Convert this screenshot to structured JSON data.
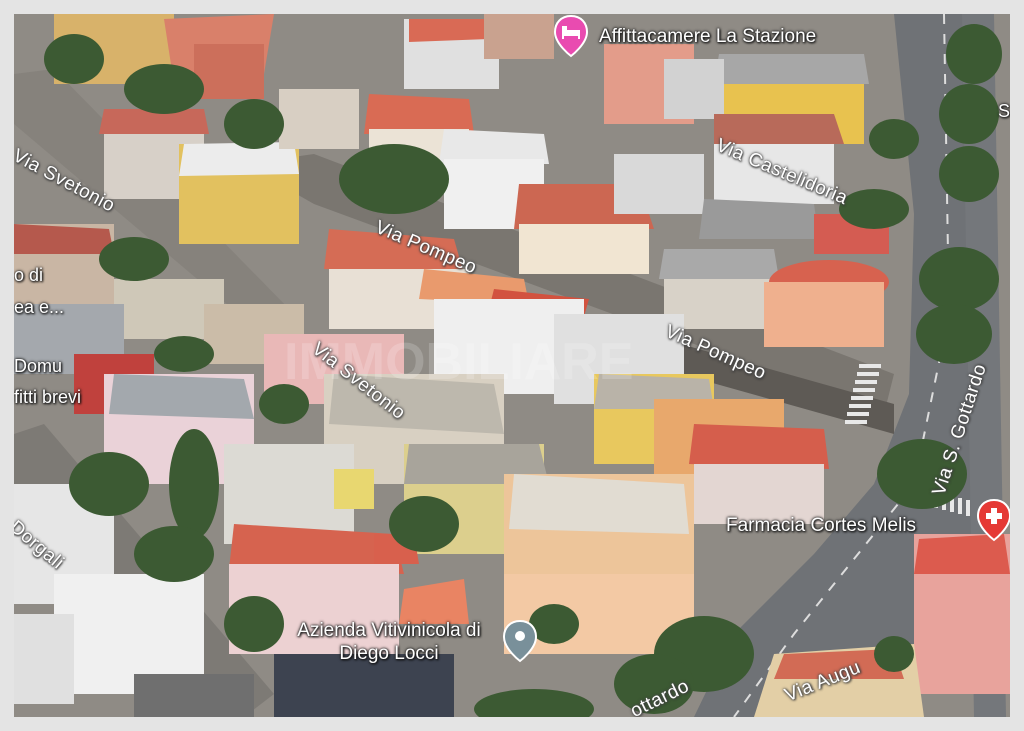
{
  "map": {
    "pois": [
      {
        "name": "Affittacamere La Stazione",
        "icon": "hotel-bed-icon",
        "color": "#e94bb0"
      },
      {
        "name": "Farmacia Cortes Melis",
        "icon": "pharmacy-cross-icon",
        "color": "#e53935"
      },
      {
        "name": "Azienda Vitivinicola di Diego Locci",
        "icon": "place-pin-icon",
        "color": "#79909a"
      }
    ],
    "street_labels": {
      "via_svetonio_top": "Via Svetonio",
      "via_pompeo_top": "Via Pompeo",
      "via_castelidoria": "Via Castelidoria",
      "via_pompeo_mid": "Via Pompeo",
      "via_svetonio_mid": "Via Svetonio",
      "via_s_gottardo_v": "Via S. Gottardo",
      "dorgali": "Dorgali",
      "gottardo_bottom": "ottardo",
      "via_augu": "Via Augu"
    },
    "partial_labels": {
      "left_1": "o di",
      "left_2": "ea e...",
      "left_3": "Domu",
      "left_4": "fitti brevi",
      "right_edge": "S"
    },
    "watermark": "IMMOBILIARE"
  }
}
